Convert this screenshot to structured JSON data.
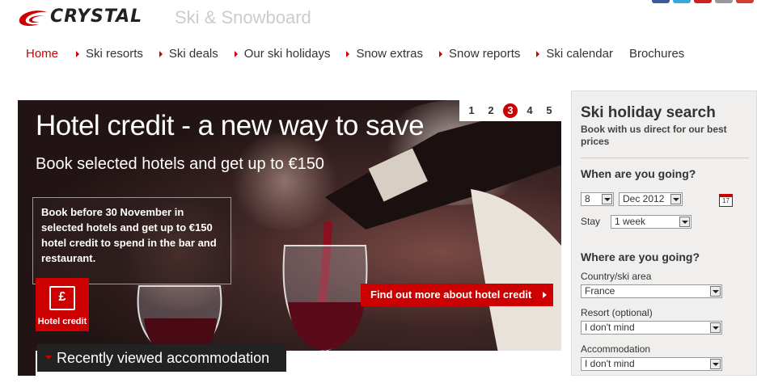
{
  "brand": {
    "logo_text": "CRYSTAL",
    "tagline": "Ski & Snowboard",
    "accent": "#cc0000"
  },
  "social": [
    "facebook-icon",
    "twitter-icon",
    "youtube-icon",
    "email-icon",
    "googleplus-icon"
  ],
  "nav": {
    "home": "Home",
    "items": [
      "Ski resorts",
      "Ski deals",
      "Our ski holidays",
      "Snow extras",
      "Snow reports",
      "Ski calendar",
      "Brochures"
    ]
  },
  "hero": {
    "title": "Hotel credit - a new way to save",
    "subtitle": "Book selected hotels and get up to €150",
    "box_text": "Book before 30 November in selected hotels and get up to €150 hotel credit to spend in the bar and restaurant.",
    "badge_label": "Hotel credit",
    "badge_symbol": "£",
    "cta": "Find out more about hotel credit",
    "pager": [
      "1",
      "2",
      "3",
      "4",
      "5"
    ],
    "active_page": "3"
  },
  "recent": {
    "label": "Recently viewed accommodation"
  },
  "search": {
    "title": "Ski holiday search",
    "intro": "Book with us direct for our best prices",
    "when_heading": "When are you going?",
    "day": "8",
    "month": "Dec 2012",
    "calendar_day": "17",
    "stay_label": "Stay",
    "stay": "1 week",
    "where_heading": "Where are you going?",
    "country_label": "Country/ski area",
    "country": "France",
    "resort_label": "Resort (optional)",
    "resort": "I don't mind",
    "accommodation_label": "Accommodation",
    "accommodation": "I don't mind"
  }
}
